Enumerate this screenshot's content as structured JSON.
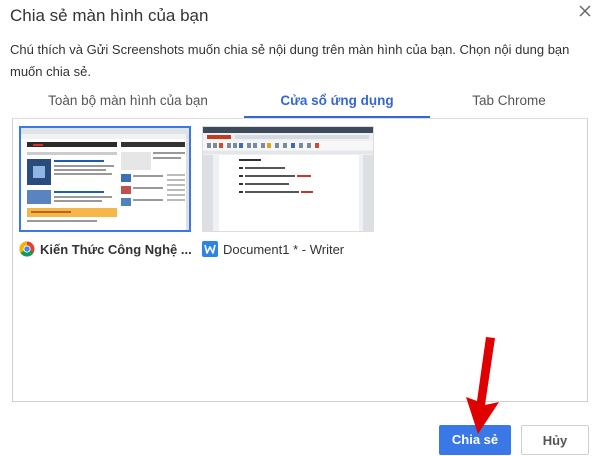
{
  "dialog": {
    "title": "Chia sẻ màn hình của bạn",
    "description": "Chú thích và Gửi Screenshots muốn chia sẻ nội dung trên màn hình của bạn. Chọn nội dung bạn muốn chia sẻ."
  },
  "tabs": [
    {
      "label": "Toàn bộ màn hình của bạn",
      "active": false
    },
    {
      "label": "Cửa sổ ứng dụng",
      "active": true
    },
    {
      "label": "Tab Chrome",
      "active": false
    }
  ],
  "sources": [
    {
      "label": "Kiến Thức Công Nghệ ...",
      "icon": "chrome-icon",
      "selected": true
    },
    {
      "label": "Document1 * - Writer",
      "icon": "wps-writer-icon",
      "selected": false
    }
  ],
  "buttons": {
    "share": "Chia sẻ",
    "cancel": "Hủy"
  },
  "colors": {
    "accent": "#3b78e7",
    "tab_active": "#3367d6",
    "arrow": "#e00000"
  }
}
